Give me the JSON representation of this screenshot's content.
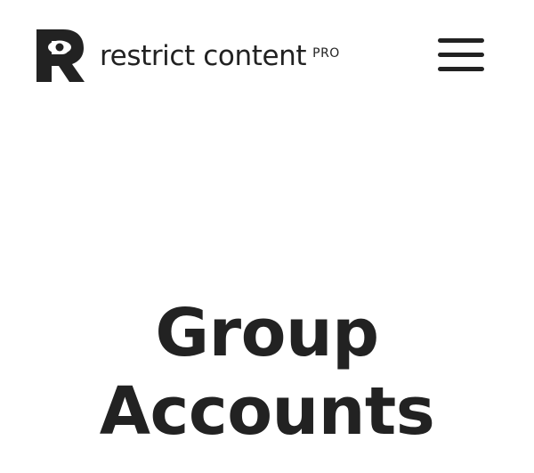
{
  "header": {
    "logo": {
      "icon": "restrict-content-r-eye-logo",
      "brand_name": "restrict content",
      "badge": "PRO"
    },
    "menu_icon": "hamburger-menu-icon"
  },
  "hero": {
    "title_line_1": "Group",
    "title_line_2": "Accounts"
  },
  "colors": {
    "text": "#222222",
    "background": "#ffffff"
  }
}
